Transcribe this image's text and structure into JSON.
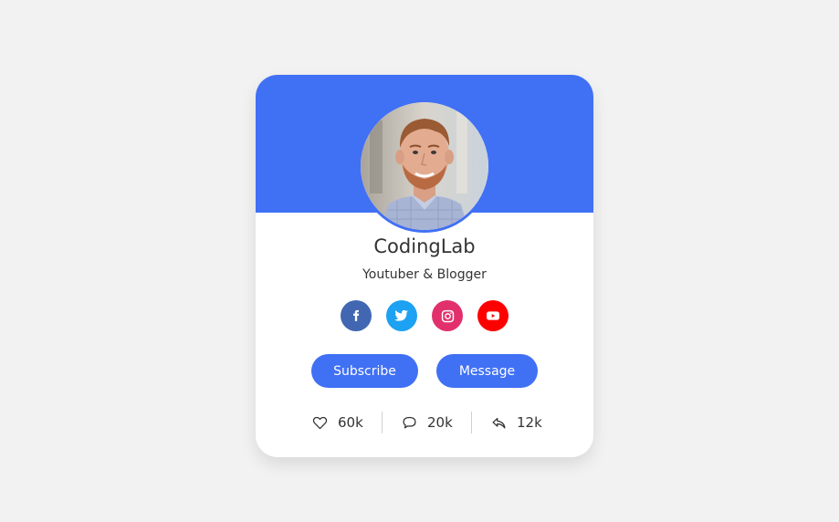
{
  "profile": {
    "name": "CodingLab",
    "role": "Youtuber & Blogger"
  },
  "socials": [
    {
      "name": "facebook",
      "icon": "facebook-icon",
      "color": "#4267b2"
    },
    {
      "name": "twitter",
      "icon": "twitter-icon",
      "color": "#1da1f2"
    },
    {
      "name": "instagram",
      "icon": "instagram-icon",
      "color": "#e1306c"
    },
    {
      "name": "youtube",
      "icon": "youtube-icon",
      "color": "#ff0000"
    }
  ],
  "buttons": {
    "subscribe_label": "Subscribe",
    "message_label": "Message"
  },
  "stats": {
    "likes": {
      "icon": "heart-icon",
      "value": "60k"
    },
    "comments": {
      "icon": "comment-icon",
      "value": "20k"
    },
    "shares": {
      "icon": "share-icon",
      "value": "12k"
    }
  },
  "colors": {
    "accent": "#4070f4",
    "background": "#f2f2f2",
    "card": "#ffffff",
    "text": "#333333"
  }
}
